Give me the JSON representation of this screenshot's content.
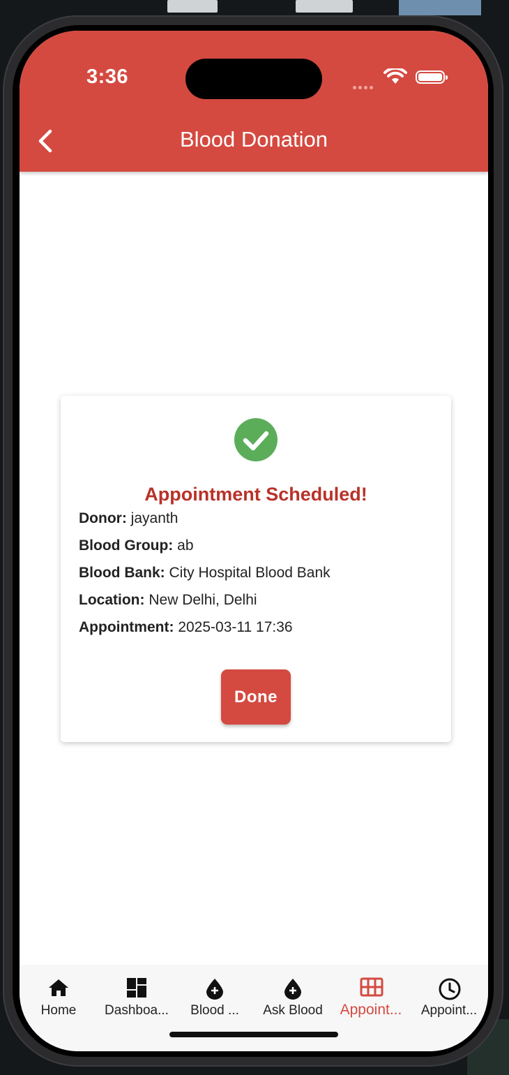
{
  "status_bar": {
    "time": "3:36"
  },
  "header": {
    "title": "Blood Donation",
    "back_icon": "chevron-left-icon"
  },
  "confirmation": {
    "icon": "check-circle-icon",
    "title": "Appointment Scheduled!",
    "details": [
      {
        "label": "Donor:",
        "value": "jayanth"
      },
      {
        "label": "Blood Group:",
        "value": "ab"
      },
      {
        "label": "Blood Bank:",
        "value": "City Hospital Blood Bank"
      },
      {
        "label": "Location:",
        "value": "New Delhi, Delhi"
      },
      {
        "label": "Appointment:",
        "value": "2025-03-11 17:36"
      }
    ],
    "done_label": "Done"
  },
  "bottom_nav": {
    "items": [
      {
        "label": "Home",
        "icon": "home-icon",
        "active": false
      },
      {
        "label": "Dashboa...",
        "icon": "dashboard-icon",
        "active": false
      },
      {
        "label": "Blood ...",
        "icon": "blood-drop-icon",
        "active": false
      },
      {
        "label": "Ask Blood",
        "icon": "blood-drop-icon",
        "active": false
      },
      {
        "label": "Appoint...",
        "icon": "grid-icon",
        "active": true
      },
      {
        "label": "Appoint...",
        "icon": "clock-icon",
        "active": false
      }
    ]
  },
  "colors": {
    "primary": "#d44a40",
    "success": "#5cad5a",
    "title_red": "#b83229"
  }
}
